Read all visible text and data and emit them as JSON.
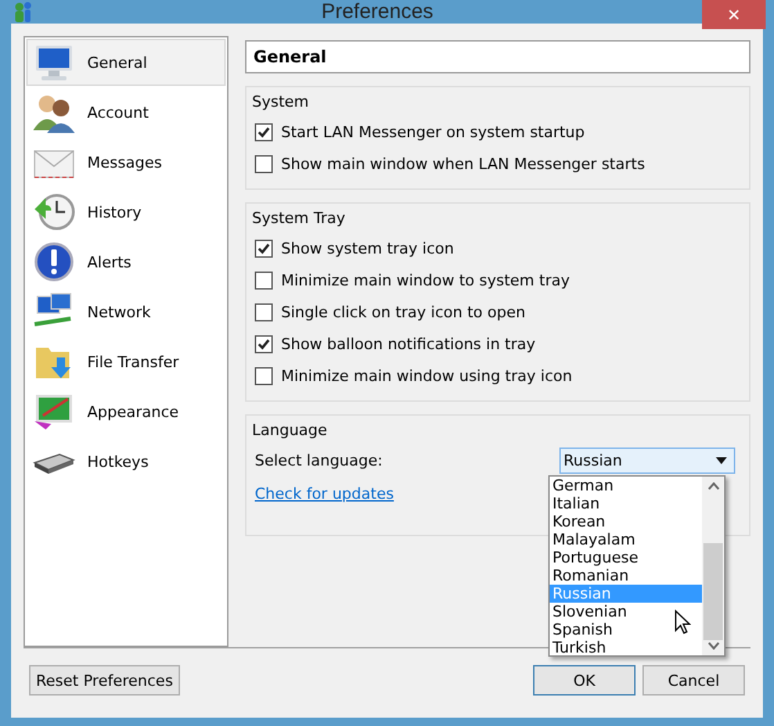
{
  "window": {
    "title": "Preferences",
    "close": "✕"
  },
  "sidebar": {
    "items": [
      {
        "label": "General",
        "selected": true
      },
      {
        "label": "Account",
        "selected": false
      },
      {
        "label": "Messages",
        "selected": false
      },
      {
        "label": "History",
        "selected": false
      },
      {
        "label": "Alerts",
        "selected": false
      },
      {
        "label": "Network",
        "selected": false
      },
      {
        "label": "File Transfer",
        "selected": false
      },
      {
        "label": "Appearance",
        "selected": false
      },
      {
        "label": "Hotkeys",
        "selected": false
      }
    ]
  },
  "page_title": "General",
  "groups": [
    {
      "title": "System",
      "options": [
        {
          "label": "Start LAN Messenger on system startup",
          "checked": true
        },
        {
          "label": "Show main window when LAN Messenger starts",
          "checked": false
        }
      ]
    },
    {
      "title": "System Tray",
      "options": [
        {
          "label": "Show system tray icon",
          "checked": true
        },
        {
          "label": "Minimize main window to system tray",
          "checked": false
        },
        {
          "label": "Single click on tray icon to open",
          "checked": false
        },
        {
          "label": "Show balloon notifications in tray",
          "checked": true
        },
        {
          "label": "Minimize main window using tray icon",
          "checked": false
        }
      ]
    }
  ],
  "language": {
    "title": "Language",
    "label": "Select language:",
    "value": "Russian",
    "link": "Check for updates",
    "options": [
      {
        "label": "German",
        "selected": false
      },
      {
        "label": "Italian",
        "selected": false
      },
      {
        "label": "Korean",
        "selected": false
      },
      {
        "label": "Malayalam",
        "selected": false
      },
      {
        "label": "Portuguese",
        "selected": false
      },
      {
        "label": "Romanian",
        "selected": false
      },
      {
        "label": "Russian",
        "selected": true
      },
      {
        "label": "Slovenian",
        "selected": false
      },
      {
        "label": "Spanish",
        "selected": false
      },
      {
        "label": "Turkish",
        "selected": false
      }
    ]
  },
  "buttons": {
    "reset": "Reset Preferences",
    "ok": "OK",
    "cancel": "Cancel"
  }
}
